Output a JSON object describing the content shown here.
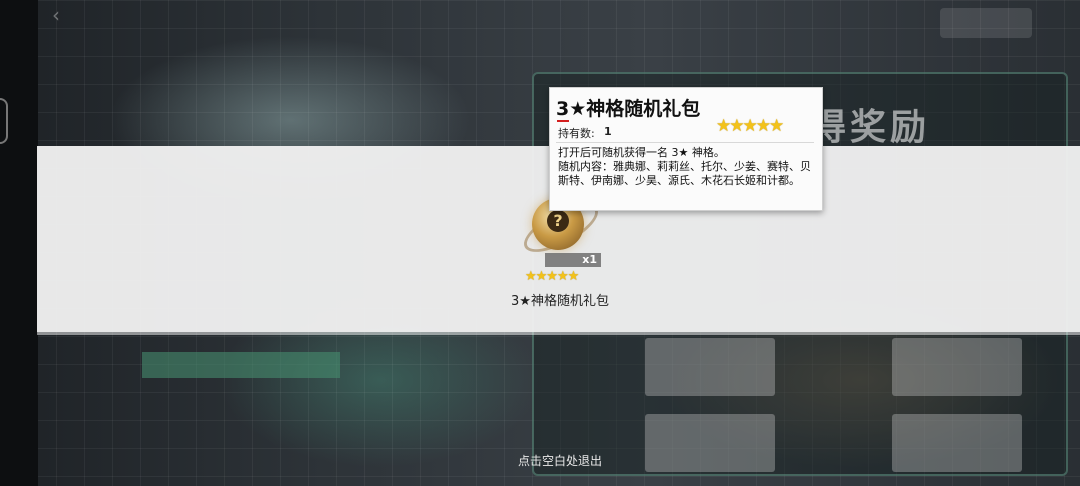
{
  "background": {
    "title_fragment": "得奖励"
  },
  "reward": {
    "item_name": "3★神格随机礼包",
    "quantity": "x1",
    "stars": "★★★★★",
    "icon": "mystery-orb-icon"
  },
  "tooltip": {
    "title": "3★神格随机礼包",
    "owned_label": "持有数:",
    "owned_count": "1",
    "stars": "★★★★★",
    "description_line1": "打开后可随机获得一名 3★ 神格。",
    "description_line2": "随机内容：雅典娜、莉莉丝、托尔、少姜、赛特、贝斯特、伊南娜、少昊、源氏、木花石长姬和计都。"
  },
  "footer": {
    "exit_hint": "点击空白处退出"
  },
  "colors": {
    "star": "#f3c21a",
    "accent_red": "#d41f1f",
    "band": "#f0f0f0"
  }
}
